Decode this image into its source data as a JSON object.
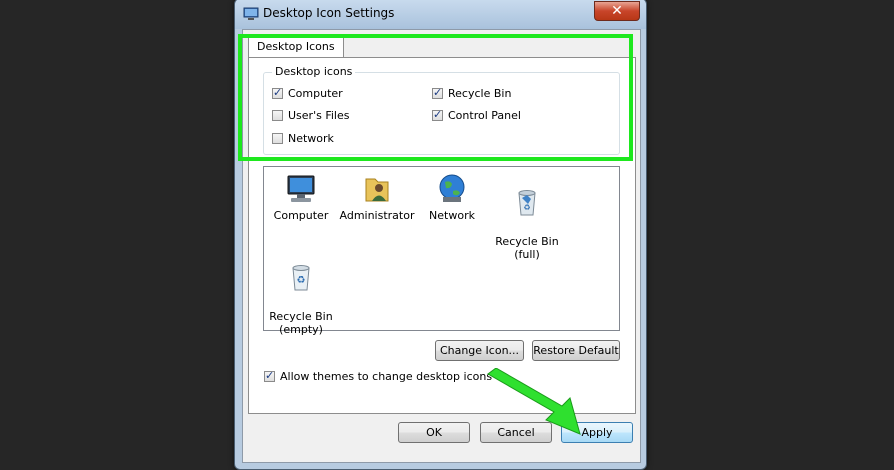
{
  "window": {
    "title": "Desktop Icon Settings",
    "close_label": "✕",
    "tab_label": "Desktop Icons"
  },
  "group": {
    "title": "Desktop icons",
    "checkboxes": [
      {
        "label": "Computer",
        "checked": true
      },
      {
        "label": "User's Files",
        "checked": false
      },
      {
        "label": "Network",
        "checked": false
      },
      {
        "label": "Recycle Bin",
        "checked": true
      },
      {
        "label": "Control Panel",
        "checked": true
      }
    ]
  },
  "icons": [
    {
      "label": "Computer",
      "icon": "computer-icon"
    },
    {
      "label": "Administrator",
      "icon": "user-folder-icon"
    },
    {
      "label": "Network",
      "icon": "network-globe-icon"
    },
    {
      "label": "Recycle Bin\n(full)",
      "icon": "recycle-bin-full-icon"
    },
    {
      "label": "Recycle Bin\n(empty)",
      "icon": "recycle-bin-empty-icon"
    }
  ],
  "buttons": {
    "change_icon": "Change Icon...",
    "restore_default": "Restore Default",
    "ok": "OK",
    "cancel": "Cancel",
    "apply": "Apply"
  },
  "allow_themes": {
    "label": "Allow themes to change desktop icons",
    "checked": true
  },
  "colors": {
    "highlight": "#1ee81e",
    "background": "#262626"
  }
}
